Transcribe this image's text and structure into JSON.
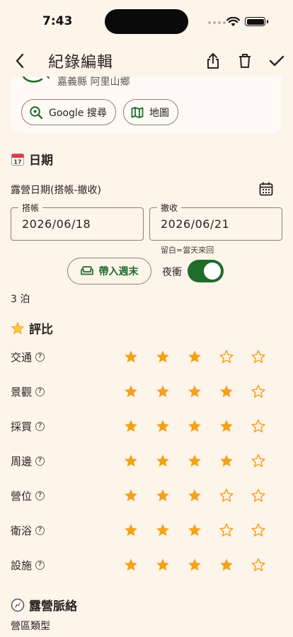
{
  "status_bar": {
    "time": "7:43"
  },
  "app_bar": {
    "title": "紀錄編輯"
  },
  "place_card": {
    "address": "嘉義縣 阿里山鄉",
    "google_search_label": "Google 搜尋",
    "map_label": "地圖"
  },
  "date_section": {
    "title": "日期",
    "field_label": "露營日期(搭帳-撤收)",
    "checkin_label": "搭帳",
    "checkin_value": "2026/06/18",
    "checkout_label": "撤收",
    "checkout_value": "2026/06/21",
    "helper": "留白=當天來回",
    "weekend_button": "帶入週末",
    "overnight_label": "夜衝",
    "overnight_on": true,
    "nights": "3 泊"
  },
  "rating_section": {
    "title": "評比",
    "max_stars": 5,
    "items": [
      {
        "label": "交通",
        "value": 3
      },
      {
        "label": "景觀",
        "value": 4
      },
      {
        "label": "採買",
        "value": 4
      },
      {
        "label": "周邊",
        "value": 4
      },
      {
        "label": "營位",
        "value": 3
      },
      {
        "label": "衛浴",
        "value": 3
      },
      {
        "label": "設施",
        "value": 4
      }
    ]
  },
  "context_section": {
    "title": "露營脈絡",
    "field_label": "營區類型"
  },
  "colors": {
    "background": "#FDF4EA",
    "accent_green": "#1E6B2A",
    "star": "#F4A11B"
  },
  "icons": {
    "back": "back-arrow-icon",
    "share": "share-icon",
    "delete": "trash-icon",
    "save": "check-icon",
    "calendar": "calendar-icon",
    "date_emoji": "calendar-emoji-icon",
    "rating_emoji": "star-emoji-icon",
    "context_emoji": "compass-emoji-icon"
  }
}
